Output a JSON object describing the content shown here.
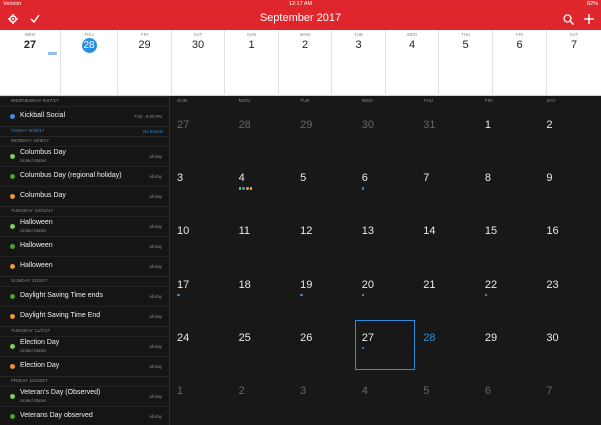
{
  "status_bar": {
    "carrier": "Verizon",
    "time": "12:17 AM",
    "battery": "82%"
  },
  "toolbar": {
    "title": "September 2017",
    "settings_icon": "gear-icon",
    "check_icon": "checkmark-icon",
    "search_icon": "search-icon",
    "add_icon": "plus-icon"
  },
  "week_strip": {
    "days": [
      {
        "weekday": "WED",
        "num": "27",
        "bold": true,
        "today": false
      },
      {
        "weekday": "THU",
        "num": "28",
        "bold": false,
        "today": true
      },
      {
        "weekday": "FRI",
        "num": "29",
        "bold": false,
        "today": false
      },
      {
        "weekday": "SAT",
        "num": "30",
        "bold": false,
        "today": false
      },
      {
        "weekday": "SUN",
        "num": "1",
        "bold": false,
        "today": false
      },
      {
        "weekday": "MON",
        "num": "2",
        "bold": false,
        "today": false
      },
      {
        "weekday": "TUE",
        "num": "3",
        "bold": false,
        "today": false
      },
      {
        "weekday": "WED",
        "num": "4",
        "bold": false,
        "today": false
      },
      {
        "weekday": "THU",
        "num": "5",
        "bold": false,
        "today": false
      },
      {
        "weekday": "FRI",
        "num": "6",
        "bold": false,
        "today": false
      },
      {
        "weekday": "SAT",
        "num": "7",
        "bold": false,
        "today": false
      }
    ]
  },
  "agenda": [
    {
      "header": "WEDNESDAY 9/27/17"
    },
    {
      "title": "Kickball Social",
      "time": "7:00 - 8:00 PM",
      "color": "#3b8fe0"
    },
    {
      "header": "TODAY 9/28/17",
      "today": true,
      "note": "No Events"
    },
    {
      "header": "MONDAY 10/9/17"
    },
    {
      "title": "Columbus Day",
      "subtitle": "United States",
      "time": "all-day",
      "color": "#7bd04b"
    },
    {
      "title": "Columbus Day (regional holiday)",
      "time": "all-day",
      "color": "#4f9f3a"
    },
    {
      "title": "Columbus Day",
      "time": "all-day",
      "color": "#f09236"
    },
    {
      "header": "TUESDAY 10/31/17"
    },
    {
      "title": "Halloween",
      "subtitle": "United States",
      "time": "all-day",
      "color": "#7bd04b"
    },
    {
      "title": "Halloween",
      "time": "all-day",
      "color": "#4f9f3a"
    },
    {
      "title": "Halloween",
      "time": "all-day",
      "color": "#f09236"
    },
    {
      "header": "SUNDAY 11/5/17"
    },
    {
      "title": "Daylight Saving Time ends",
      "time": "all-day",
      "color": "#4f9f3a"
    },
    {
      "title": "Daylight Saving Time End",
      "time": "all-day",
      "color": "#f09236"
    },
    {
      "header": "TUESDAY 11/7/17"
    },
    {
      "title": "Election Day",
      "subtitle": "United States",
      "time": "all-day",
      "color": "#7bd04b"
    },
    {
      "title": "Election Day",
      "time": "all-day",
      "color": "#f09236"
    },
    {
      "header": "FRIDAY 11/10/17"
    },
    {
      "title": "Veteran's Day (Observed)",
      "subtitle": "United States",
      "time": "all-day",
      "color": "#7bd04b"
    },
    {
      "title": "Veterans Day observed",
      "time": "all-day",
      "color": "#4f9f3a"
    }
  ],
  "month": {
    "weekdays": [
      "SUN",
      "MON",
      "TUE",
      "WED",
      "THU",
      "FRI",
      "SAT"
    ],
    "weeks": [
      [
        {
          "n": "27",
          "muted": true
        },
        {
          "n": "28",
          "muted": true
        },
        {
          "n": "29",
          "muted": true
        },
        {
          "n": "30",
          "muted": true
        },
        {
          "n": "31",
          "muted": true
        },
        {
          "n": "1"
        },
        {
          "n": "2"
        }
      ],
      [
        {
          "n": "3"
        },
        {
          "n": "4",
          "dots": [
            "#7bd04b",
            "#3b8fe0",
            "#f09236",
            "#f0c33c"
          ]
        },
        {
          "n": "5"
        },
        {
          "n": "6",
          "dots": [
            "#3b8fe0"
          ]
        },
        {
          "n": "7"
        },
        {
          "n": "8"
        },
        {
          "n": "9"
        }
      ],
      [
        {
          "n": "10"
        },
        {
          "n": "11"
        },
        {
          "n": "12"
        },
        {
          "n": "13"
        },
        {
          "n": "14"
        },
        {
          "n": "15"
        },
        {
          "n": "16"
        }
      ],
      [
        {
          "n": "17",
          "dots": [
            "#3b8fe0"
          ]
        },
        {
          "n": "18"
        },
        {
          "n": "19",
          "dots": [
            "#3b8fe0"
          ]
        },
        {
          "n": "20",
          "dots": [
            "#c56cd6"
          ]
        },
        {
          "n": "21"
        },
        {
          "n": "22",
          "dots": [
            "#c56cd6"
          ]
        },
        {
          "n": "23"
        }
      ],
      [
        {
          "n": "24"
        },
        {
          "n": "25"
        },
        {
          "n": "26"
        },
        {
          "n": "27",
          "dots": [
            "#3b8fe0"
          ],
          "selected": true
        },
        {
          "n": "28",
          "today": true
        },
        {
          "n": "29"
        },
        {
          "n": "30"
        }
      ],
      [
        {
          "n": "1",
          "muted": true
        },
        {
          "n": "2",
          "muted": true
        },
        {
          "n": "3",
          "muted": true
        },
        {
          "n": "4",
          "muted": true
        },
        {
          "n": "5",
          "muted": true
        },
        {
          "n": "6",
          "muted": true
        },
        {
          "n": "7",
          "muted": true
        }
      ]
    ]
  },
  "colors": {
    "accent": "#e0262d",
    "today_blue": "#2f8bdf"
  }
}
